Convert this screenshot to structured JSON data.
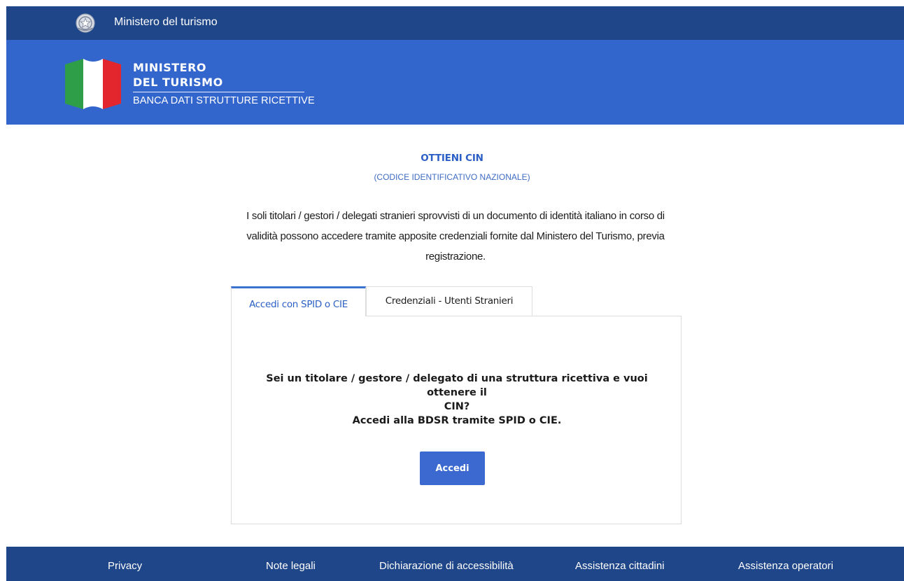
{
  "top_bar": {
    "title": "Ministero del turismo",
    "emblem_icon": "italian-republic-emblem-icon"
  },
  "header": {
    "brand_line1": "MINISTERO",
    "brand_line2": "DEL TURISMO",
    "brand_subtitle": "BANCA DATI STRUTTURE RICETTIVE",
    "flag_icon": "italian-flag-icon",
    "colors": {
      "primary": "#3366cc",
      "dark": "#1f4689",
      "green": "#2e9e48",
      "red": "#e3262d"
    }
  },
  "main": {
    "title": "OTTIENI CIN",
    "subtitle": "(CODICE IDENTIFICATIVO NAZIONALE)",
    "intro_line1": "I soli titolari / gestori / delegati stranieri sprovvisti di un documento di identità italiano in corso di",
    "intro_line2": "validità possono accedere tramite apposite credenziali fornite dal Ministero del Turismo, previa",
    "intro_line3": "registrazione.",
    "tabs": [
      {
        "label": "Accedi con SPID o CIE",
        "active": true
      },
      {
        "label": "Credenziali - Utenti Stranieri",
        "active": false
      }
    ],
    "panel": {
      "message_line1": "Sei un titolare / gestore / delegato di una struttura ricettiva e vuoi ottenere il",
      "message_line2": "CIN?",
      "message_line3": "Accedi alla BDSR tramite SPID o CIE.",
      "button_label": "Accedi"
    }
  },
  "footer": {
    "links": [
      "Privacy",
      "Note legali",
      "Dichiarazione di accessibilità",
      "Assistenza cittadini",
      "Assistenza operatori"
    ]
  }
}
